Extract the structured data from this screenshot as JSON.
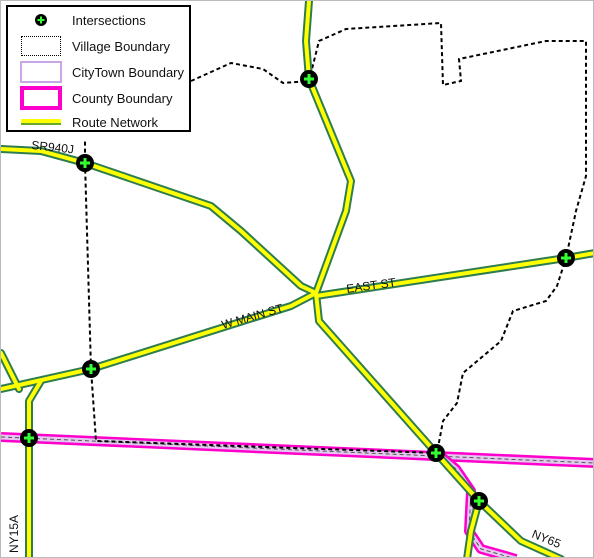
{
  "legend": {
    "items": [
      {
        "label": "Intersections",
        "icon": "green-cross-point-icon"
      },
      {
        "label": "Village Boundary",
        "icon": "dashed-black-polygon-icon"
      },
      {
        "label": "CityTown Boundary",
        "icon": "purple-polygon-icon"
      },
      {
        "label": "County Boundary",
        "icon": "magenta-polygon-icon"
      },
      {
        "label": "Route Network",
        "icon": "yellow-green-line-icon"
      }
    ]
  },
  "labels": {
    "sr940j": "SR940J",
    "w_main_st": "W MAIN ST",
    "east_st": "EAST ST",
    "ny15a": "NY15A",
    "ny65": "NY65"
  },
  "colors": {
    "road_fill": "#ffff00",
    "road_casing": "#2e7d4f",
    "county": "#ff00cc",
    "citytown": "#c9a6e6",
    "village": "#000000",
    "intersection": "#33ff33"
  }
}
